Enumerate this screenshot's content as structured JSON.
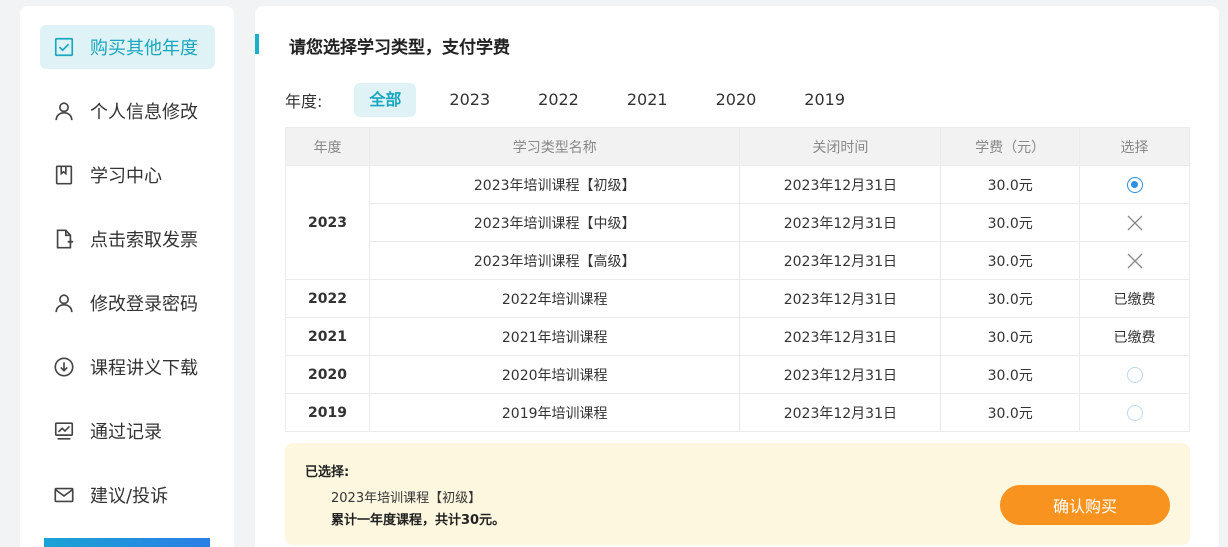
{
  "sidebar": {
    "items": [
      {
        "label": "购买其他年度",
        "icon": "checkbox-icon",
        "active": true
      },
      {
        "label": "个人信息修改",
        "icon": "user-icon"
      },
      {
        "label": "学习中心",
        "icon": "book-icon"
      },
      {
        "label": "点击索取发票",
        "icon": "invoice-icon"
      },
      {
        "label": "修改登录密码",
        "icon": "user-lock-icon"
      },
      {
        "label": "课程讲义下载",
        "icon": "download-icon"
      },
      {
        "label": "通过记录",
        "icon": "chart-icon"
      },
      {
        "label": "建议/投诉",
        "icon": "mail-icon"
      }
    ]
  },
  "main": {
    "title": "请您选择学习类型，支付学费",
    "year_filter": {
      "label": "年度:",
      "options": [
        "全部",
        "2023",
        "2022",
        "2021",
        "2020",
        "2019"
      ],
      "selected": "全部"
    },
    "table": {
      "headers": [
        "年度",
        "学习类型名称",
        "关闭时间",
        "学费（元）",
        "选择"
      ],
      "rows": [
        {
          "year": "2023",
          "name": "2023年培训课程【初级】",
          "close": "2023年12月31日",
          "fee": "30.0元",
          "select": "radio-checked"
        },
        {
          "year": "",
          "name": "2023年培训课程【中级】",
          "close": "2023年12月31日",
          "fee": "30.0元",
          "select": "x"
        },
        {
          "year": "",
          "name": "2023年培训课程【高级】",
          "close": "2023年12月31日",
          "fee": "30.0元",
          "select": "x"
        },
        {
          "year": "2022",
          "name": "2022年培训课程",
          "close": "2023年12月31日",
          "fee": "30.0元",
          "select": "已缴费"
        },
        {
          "year": "2021",
          "name": "2021年培训课程",
          "close": "2023年12月31日",
          "fee": "30.0元",
          "select": "已缴费"
        },
        {
          "year": "2020",
          "name": "2020年培训课程",
          "close": "2023年12月31日",
          "fee": "30.0元",
          "select": "radio"
        },
        {
          "year": "2019",
          "name": "2019年培训课程",
          "close": "2023年12月31日",
          "fee": "30.0元",
          "select": "radio"
        }
      ]
    },
    "summary": {
      "label": "已选择:",
      "item": "2023年培训课程【初级】",
      "total": "累计一年度课程，共计30元。",
      "confirm_label": "确认购买"
    }
  },
  "colors": {
    "accent": "#1aa6bf",
    "button": "#f7931e",
    "radio": "#2b8fe3",
    "summary_bg": "#fdf7e0"
  }
}
